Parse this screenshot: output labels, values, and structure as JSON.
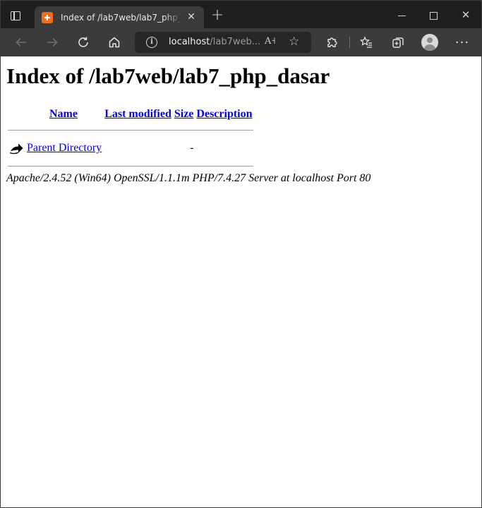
{
  "browser": {
    "tab": {
      "title": "Index of /lab7web/lab7_php_dasar",
      "favicon": "xampp-icon"
    },
    "address_bar": {
      "host": "localhost",
      "path": "/lab7web..."
    },
    "colors": {
      "chrome": "#3b3b3b",
      "tabbar": "#1f1f1f",
      "favicon": "#f26c1c",
      "link": "#0000ee"
    }
  },
  "page": {
    "heading": "Index of /lab7web/lab7_php_dasar",
    "columns": {
      "name": "Name",
      "last_modified": "Last modified",
      "size": "Size",
      "description": "Description"
    },
    "rows": [
      {
        "icon": "back-arrow-icon",
        "name": "Parent Directory",
        "last_modified": "",
        "size": "-",
        "description": ""
      }
    ],
    "footer": "Apache/2.4.52 (Win64) OpenSSL/1.1.1m PHP/7.4.27 Server at localhost Port 80"
  }
}
